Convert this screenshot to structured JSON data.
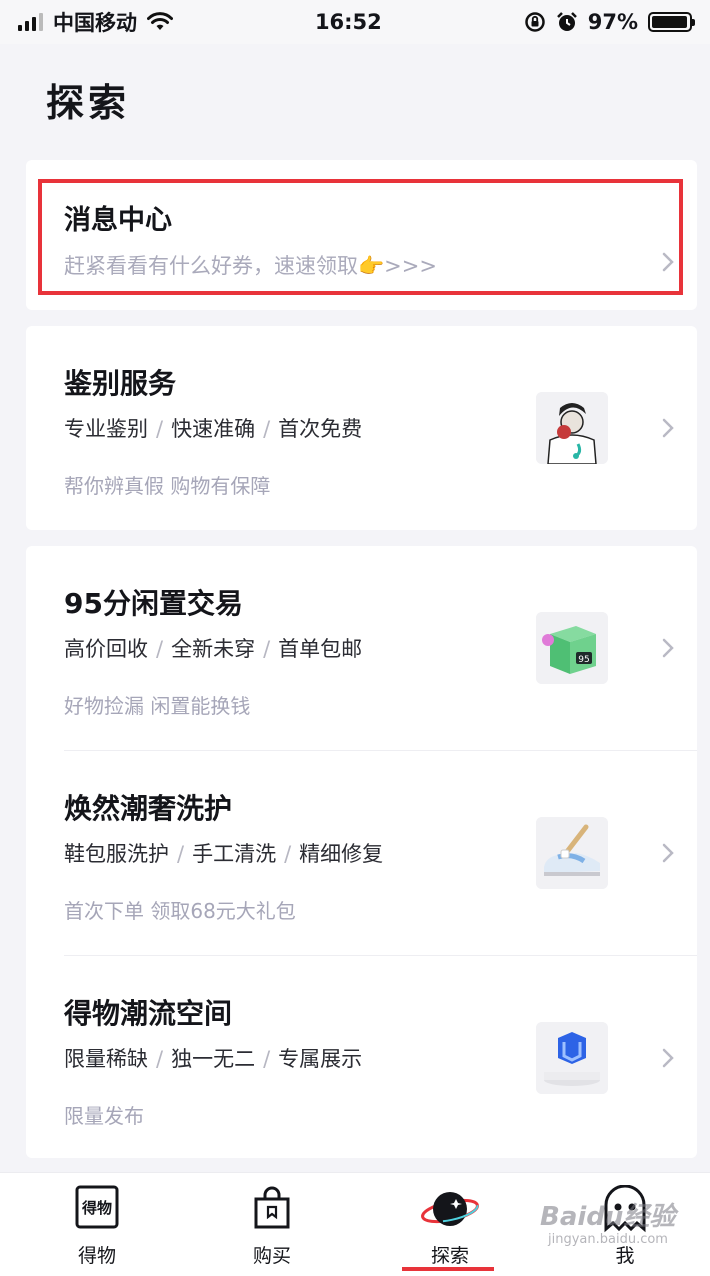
{
  "status_bar": {
    "carrier": "中国移动",
    "time": "16:52",
    "battery": "97%",
    "battery_level": 0.97,
    "icons": [
      "signal-icon",
      "wifi-icon",
      "orientation-lock-icon",
      "alarm-icon",
      "battery-icon"
    ]
  },
  "page": {
    "title": "探索"
  },
  "message_center": {
    "title": "消息中心",
    "subtitle": "赶紧看看有什么好券，速速领取👉>>>"
  },
  "services": [
    {
      "title": "鉴别服务",
      "tags": [
        "专业鉴别",
        "快速准确",
        "首次免费"
      ],
      "note": "帮你辨真假 购物有保障",
      "icon": "appraiser-icon"
    },
    {
      "title": "95分闲置交易",
      "tags": [
        "高价回收",
        "全新未穿",
        "首单包邮"
      ],
      "note": "好物捡漏 闲置能换钱",
      "icon": "green-box-95-icon",
      "badge": "95"
    },
    {
      "title": "焕然潮奢洗护",
      "tags": [
        "鞋包服洗护",
        "手工清洗",
        "精细修复"
      ],
      "note": "首次下单 领取68元大礼包",
      "icon": "sneaker-cleaning-icon"
    },
    {
      "title": "得物潮流空间",
      "tags": [
        "限量稀缺",
        "独一无二",
        "专属展示"
      ],
      "note": "限量发布",
      "icon": "blue-cube-icon"
    }
  ],
  "tabbar": {
    "tabs": [
      {
        "label": "得物",
        "icon": "dewu-logo-icon",
        "icon_text": "得物"
      },
      {
        "label": "购买",
        "icon": "shopping-bag-icon"
      },
      {
        "label": "探索",
        "icon": "planet-icon",
        "active": true
      },
      {
        "label": "我",
        "icon": "ghost-avatar-icon"
      }
    ]
  },
  "watermark": {
    "text": "Baidu经验",
    "sub": "jingyan.baidu.com"
  },
  "colors": {
    "accent": "#e8333a",
    "background": "#f4f4f8",
    "card": "#ffffff",
    "muted_text": "#a6a6b8"
  }
}
